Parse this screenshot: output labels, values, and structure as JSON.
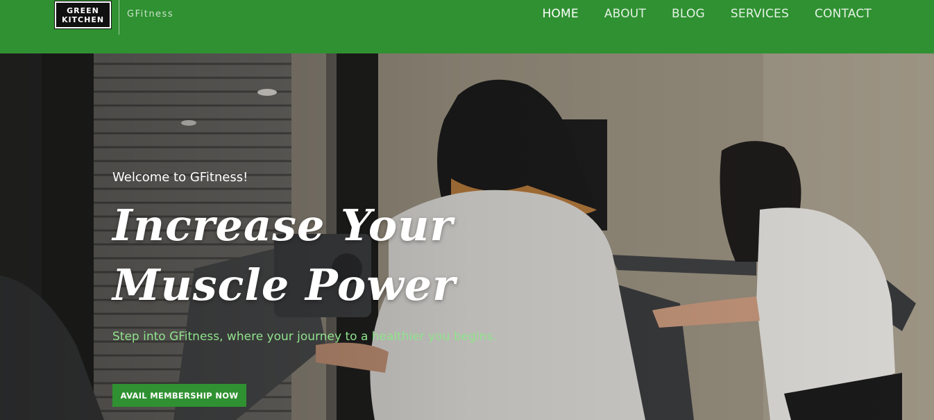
{
  "brand": {
    "logo_line1": "GREEN",
    "logo_line2": "KITCHEN",
    "name": "GFitness"
  },
  "nav": {
    "items": [
      {
        "label": "HOME",
        "active": true
      },
      {
        "label": "ABOUT"
      },
      {
        "label": "BLOG"
      },
      {
        "label": "SERVICES"
      },
      {
        "label": "CONTACT"
      }
    ]
  },
  "hero": {
    "eyebrow": "Welcome to GFitness!",
    "headline_line1": "Increase Your",
    "headline_line2": "Muscle Power",
    "subtitle": "Step into GFitness, where your journey to a healthier you begins.",
    "cta_label": "AVAIL MEMBERSHIP NOW"
  },
  "colors": {
    "header_bg": "#2f9131",
    "subtitle_text": "#8fe38c",
    "cta_bg": "#2f9131"
  }
}
